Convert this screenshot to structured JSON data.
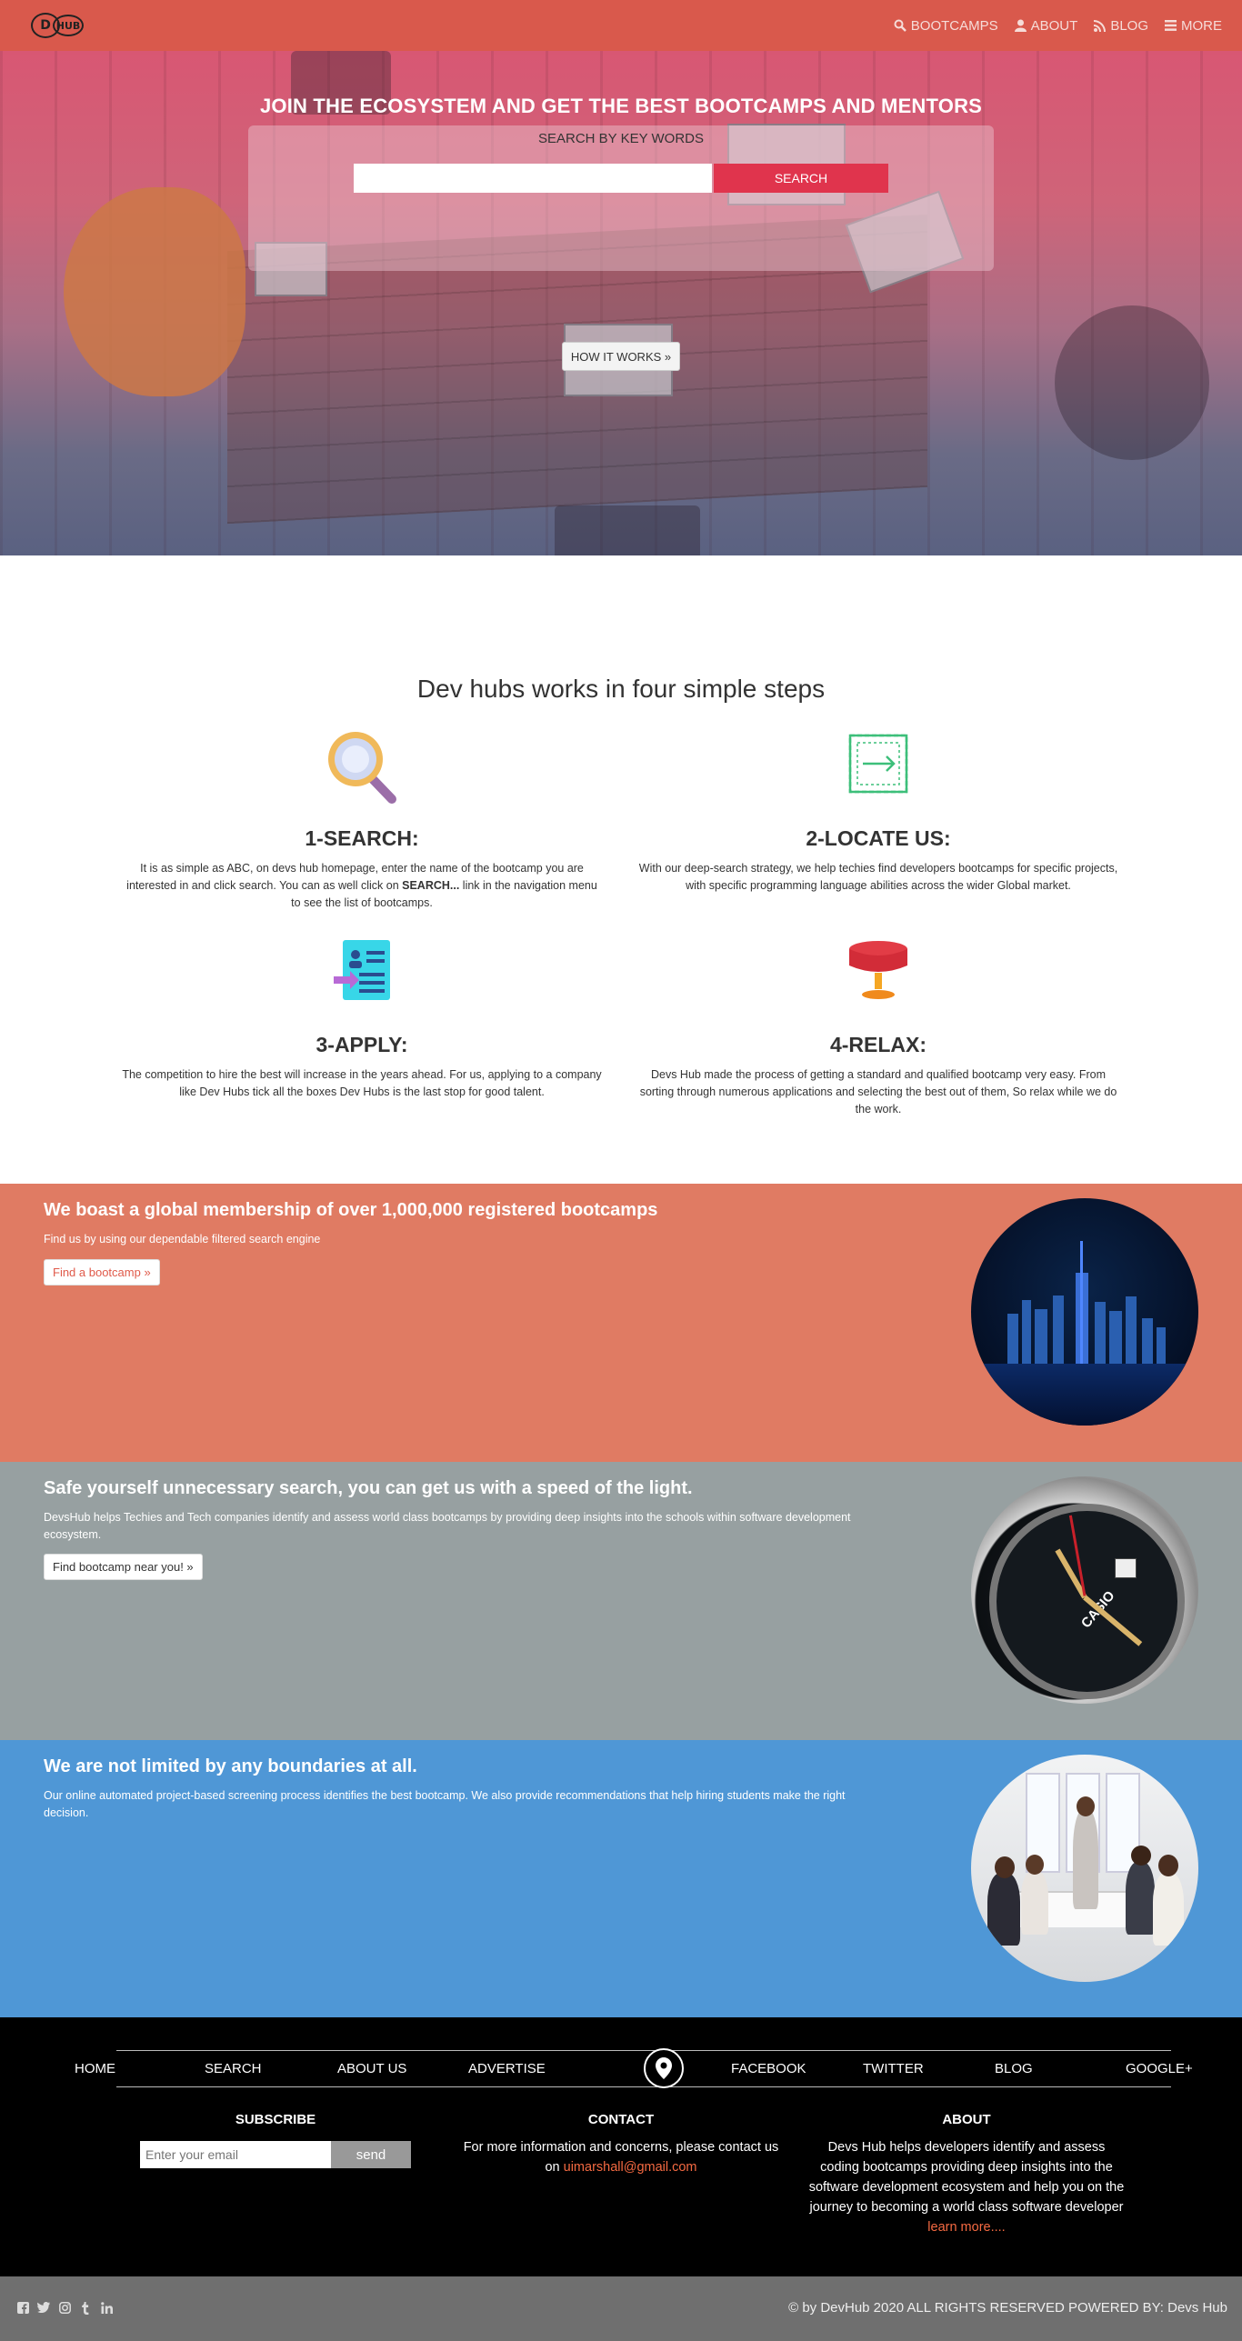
{
  "nav": {
    "logo_d": "D",
    "logo_hub": "HUB",
    "links": [
      {
        "label": "BOOTCAMPS",
        "icon": "search-icon"
      },
      {
        "label": "ABOUT",
        "icon": "user-icon"
      },
      {
        "label": "BLOG",
        "icon": "rss-icon"
      },
      {
        "label": "MORE",
        "icon": "menu-icon"
      }
    ]
  },
  "hero": {
    "title": "JOIN THE ECOSYSTEM AND GET THE BEST BOOTCAMPS AND MENTORS",
    "search_title": "SEARCH BY KEY WORDS",
    "search_value": "",
    "search_button": "SEARCH",
    "how_button": "HOW IT WORKS »"
  },
  "steps": {
    "title": "Dev hubs works in four simple steps",
    "items": [
      {
        "heading": "1-SEARCH:",
        "icon": "magnifier-icon",
        "text_before": "It is as simple as ABC, on devs hub homepage, enter the name of the bootcamp you are interested in and click search. You can as well click on ",
        "text_bold": "SEARCH...",
        "text_after": " link in the navigation menu to see the list of bootcamps."
      },
      {
        "heading": "2-LOCATE US:",
        "icon": "login-arrow-icon",
        "text_before": "With our deep-search strategy, we help techies find developers bootcamps for specific projects, with specific programming language abilities across the wider Global market.",
        "text_bold": "",
        "text_after": ""
      },
      {
        "heading": "3-APPLY:",
        "icon": "resume-icon",
        "text_before": "The competition to hire the best will increase in the years ahead. For us, applying to a company like Dev Hubs tick all the boxes Dev Hubs is the last stop for good talent.",
        "text_bold": "",
        "text_after": ""
      },
      {
        "heading": "4-RELAX:",
        "icon": "table-icon",
        "text_before": "Devs Hub made the process of getting a standard and qualified bootcamp very easy. From sorting through numerous applications and selecting the best out of them, So relax while we do the work.",
        "text_bold": "",
        "text_after": ""
      }
    ]
  },
  "bands": [
    {
      "title": "We boast a global membership of over 1,000,000 registered bootcamps",
      "text": "Find us by using our dependable filtered search engine",
      "button": "Find a bootcamp »",
      "color": "#e07b63",
      "button_color": "#e05a4a"
    },
    {
      "title": "Safe yourself unnecessary search, you can get us with a speed of the light.",
      "text": "DevsHub helps Techies and Tech companies identify and assess world class bootcamps by providing deep insights into the schools within software development ecosystem.",
      "button": "Find bootcamp near you! »",
      "color": "#97a0a1",
      "button_color": "#333333"
    },
    {
      "title": "We are not limited by any boundaries at all.",
      "text": "Our online automated project-based screening process identifies the best bootcamp. We also provide recommendations that help hiring students make the right decision.",
      "button": "",
      "color": "#4f97d6",
      "button_color": ""
    }
  ],
  "watch_brand": "CASIO",
  "footer": {
    "nav": [
      "HOME",
      "SEARCH",
      "ABOUT US",
      "ADVERTISE",
      "FACEBOOK",
      "TWITTER",
      "BLOG",
      "GOOGLE+"
    ],
    "subscribe": {
      "title": "SUBSCRIBE",
      "placeholder": "Enter your email",
      "button": "send"
    },
    "contact": {
      "title": "CONTACT",
      "text": "For more information and concerns, please contact us on ",
      "email": "uimarshall@gmail.com"
    },
    "about": {
      "title": "ABOUT",
      "text": "Devs Hub helps developers identify and assess coding bootcamps providing deep insights into the software development ecosystem and help you on the journey to becoming a world class software developer ",
      "link": "learn more...."
    }
  },
  "bottom": {
    "socials": [
      "facebook-icon",
      "twitter-icon",
      "instagram-icon",
      "tumblr-icon",
      "linkedin-icon"
    ],
    "copyright": "© by DevHub 2020 ALL RIGHTS RESERVED POWERED BY: Devs Hub"
  }
}
